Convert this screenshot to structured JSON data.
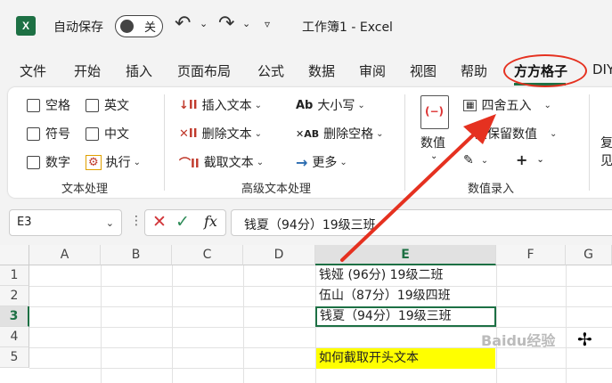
{
  "titlebar": {
    "autosave_label": "自动保存",
    "toggle_state": "关",
    "undo": "↶",
    "redo": "↷",
    "caret": "⌄",
    "qat_more": "▿",
    "doc_title": "工作簿1  -  Excel",
    "logo": "X"
  },
  "tabs": [
    "文件",
    "开始",
    "插入",
    "页面布局",
    "公式",
    "数据",
    "审阅",
    "视图",
    "帮助",
    "方方格子",
    "DIY"
  ],
  "ribbon": {
    "text_group": {
      "items": [
        "空格",
        "英文",
        "符号",
        "中文",
        "数字",
        "执行"
      ],
      "label": "文本处理"
    },
    "adv_group": {
      "items": [
        "插入文本",
        "删除文本",
        "截取文本",
        "大小写",
        "删除空格",
        "更多"
      ],
      "label": "高级文本处理",
      "icons": [
        "↓II",
        "✕II",
        "⌒II",
        "Ab",
        "✕AB",
        "→"
      ]
    },
    "num_group": {
      "main_label": "数值",
      "items": [
        "四舍五入",
        "只保留数值"
      ],
      "plus": "+",
      "label": "数值录入",
      "icon_mark": "(−)"
    },
    "next_group_partial": "复",
    "next_group_partial2": "见"
  },
  "formula_bar": {
    "name_box": "E3",
    "dots": "⋮",
    "cancel": "✕",
    "enter": "✓",
    "fx": "fx",
    "content": "钱夏（94分）19级三班"
  },
  "grid": {
    "columns": [
      "A",
      "B",
      "C",
      "D",
      "E",
      "F",
      "G"
    ],
    "rows": [
      "1",
      "2",
      "3",
      "4",
      "5"
    ],
    "cells": {
      "E1": "钱娅 (96分) 19级二班",
      "E2": "伍山（87分）19级四班",
      "E3": "钱夏（94分）19级三班",
      "E5": "如何截取开头文本"
    },
    "selected_cell": "E3",
    "highlight_color": "#ffff00"
  },
  "overlay": {
    "watermark": "Baidu经验",
    "cursor": "✢",
    "arrow_color": "#e53120"
  }
}
